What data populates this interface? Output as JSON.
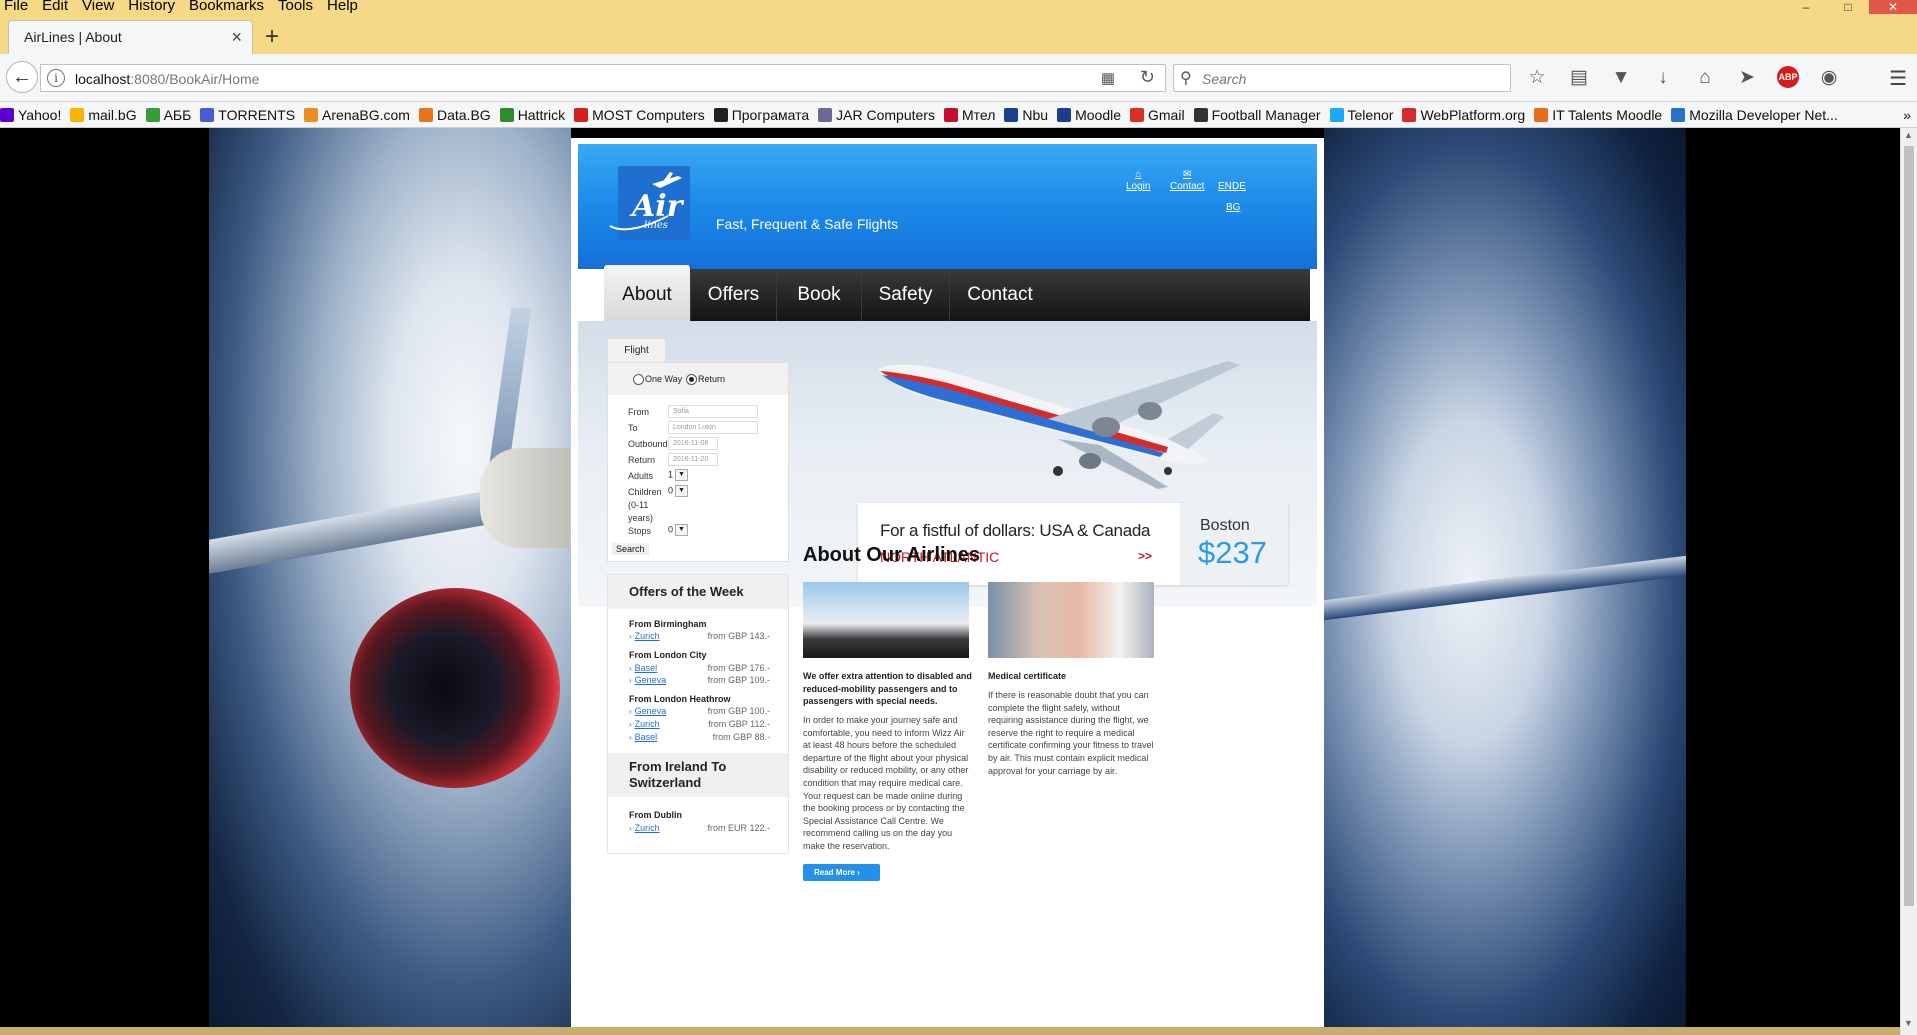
{
  "browser": {
    "menu": [
      "File",
      "Edit",
      "View",
      "History",
      "Bookmarks",
      "Tools",
      "Help"
    ],
    "tab_title": "AirLines | About",
    "url_host": "localhost",
    "url_rest": ":8080/BookAir/Home",
    "search_placeholder": "Search",
    "bookmarks": [
      {
        "label": "Yahoo!",
        "color": "#5f01d1"
      },
      {
        "label": "mail.bG",
        "color": "#f4b400"
      },
      {
        "label": "АББ",
        "color": "#3a9a3a"
      },
      {
        "label": "TORRENTS",
        "color": "#4a5bd6"
      },
      {
        "label": "ArenaBG.com",
        "color": "#e88f1f"
      },
      {
        "label": "Data.BG",
        "color": "#e8751a"
      },
      {
        "label": "Hattrick",
        "color": "#2e8b2e"
      },
      {
        "label": "MOST Computers",
        "color": "#d62020"
      },
      {
        "label": "Програмата",
        "color": "#222222"
      },
      {
        "label": "JAR Computers",
        "color": "#6a6a9a"
      },
      {
        "label": "Мтел",
        "color": "#c8102e"
      },
      {
        "label": "Nbu",
        "color": "#1d3d8f"
      },
      {
        "label": "Moodle",
        "color": "#1d3d8f"
      },
      {
        "label": "Gmail",
        "color": "#d93025"
      },
      {
        "label": "Football Manager",
        "color": "#333333"
      },
      {
        "label": "Telenor",
        "color": "#19aaf8"
      },
      {
        "label": "WebPlatform.org",
        "color": "#d62b2b"
      },
      {
        "label": "IT Talents Moodle",
        "color": "#e86c1a"
      },
      {
        "label": "Mozilla Developer Net...",
        "color": "#2a6fc9"
      }
    ],
    "bookmarks_more": "»"
  },
  "site": {
    "tagline": "Fast, Frequent & Safe Flights",
    "logo_main": "Air",
    "logo_sub": "lines",
    "links": {
      "login": "Login",
      "contact": "Contact",
      "en": "EN",
      "de": "DE",
      "bg": "BG"
    },
    "nav": [
      "About",
      "Offers",
      "Book",
      "Safety",
      "Contact"
    ],
    "active_nav": "About",
    "accent_color": "#1c8ae9"
  },
  "promo": {
    "title": "For a fistful of dollars: USA & Canada",
    "subtitle": "NORTH ATLANTIC",
    "arrows": ">>",
    "city": "Boston",
    "price": "$237"
  },
  "flight_form": {
    "tab": "Flight",
    "one_way": "One Way",
    "return": "Return",
    "selected_trip": "Return",
    "labels": {
      "from": "From",
      "to": "To",
      "outbound": "Outbound",
      "return": "Return",
      "adults": "Adults",
      "children": "Children",
      "children_note1": "(0-11",
      "children_note2": "years)",
      "stops": "Stops"
    },
    "values": {
      "from": "Sofia",
      "to": "London Luton",
      "outbound": "2016-11-06",
      "return": "2016-11-20",
      "adults": "1",
      "children": "0",
      "stops": "0"
    },
    "search": "Search"
  },
  "offers": {
    "title": "Offers of the Week",
    "groups": [
      {
        "from": "From Birmingham",
        "items": [
          {
            "city": "Zurich",
            "price": "from GBP 143.-"
          }
        ]
      },
      {
        "from": "From London City",
        "items": [
          {
            "city": "Basel",
            "price": "from GBP 176.-"
          },
          {
            "city": "Geneva",
            "price": "from GBP 109.-"
          }
        ]
      },
      {
        "from": "From London Heathrow",
        "items": [
          {
            "city": "Geneva",
            "price": "from GBP 100.-"
          },
          {
            "city": "Zurich",
            "price": "from GBP 112.-"
          },
          {
            "city": "Basel",
            "price": "from GBP 88.-"
          }
        ]
      }
    ],
    "ireland_title_1": "From Ireland To",
    "ireland_title_2": "Switzerland",
    "ireland_from": "From Dublin",
    "ireland_item": {
      "city": "Zurich",
      "price": "from EUR 122.-"
    }
  },
  "about": {
    "title": "About Our Airlines",
    "col1_title": [
      "We offer extra attention to disabled and",
      "reduced-mobility passengers and to",
      "passengers with special needs."
    ],
    "col1_body": [
      "In order to make your journey safe and",
      "comfortable, you need to inform Wizz Air",
      "at least 48 hours before the scheduled",
      "departure of the flight about your physical",
      "disability or reduced mobility, or any other",
      "condition that may require medical care.",
      "Your request can be made online during",
      "the booking process or by contacting the",
      "Special Assistance Call Centre. We",
      "recommend calling us on the day you",
      "make the reservation."
    ],
    "col2_title": "Medical certificate",
    "col2_body": [
      "If there is reasonable doubt that you can",
      "complete the flight safely, without",
      "requiring assistance during the flight, we",
      "reserve the right to require a medical",
      "certificate confirming your fitness to travel",
      "by air. This must contain explicit medical",
      "approval for your carriage by air."
    ],
    "read_more": "Read More"
  }
}
